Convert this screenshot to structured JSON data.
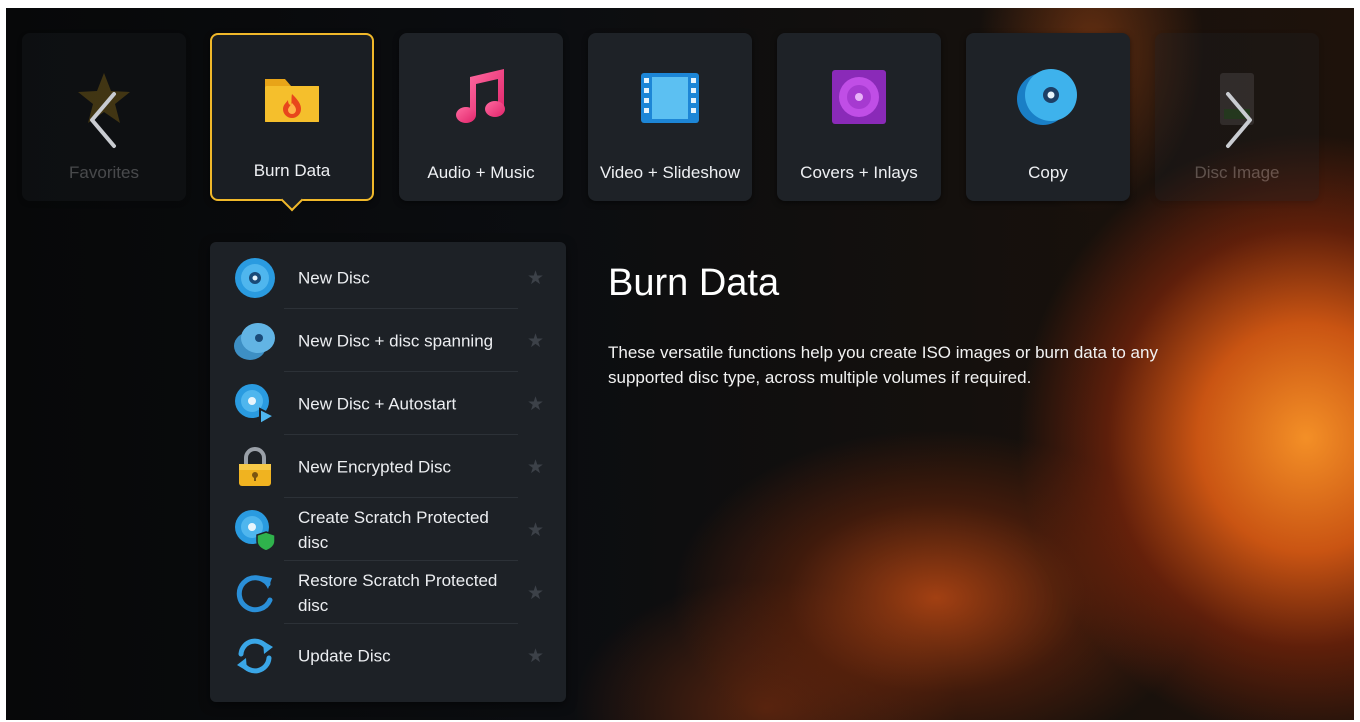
{
  "categories": [
    {
      "label": "Favorites",
      "icon": "star-icon",
      "state": "dimmed"
    },
    {
      "label": "Burn Data",
      "icon": "folder-flame-icon",
      "state": "selected"
    },
    {
      "label": "Audio + Music",
      "icon": "music-note-icon",
      "state": "normal"
    },
    {
      "label": "Video + Slideshow",
      "icon": "film-strip-icon",
      "state": "normal"
    },
    {
      "label": "Covers + Inlays",
      "icon": "disc-cover-icon",
      "state": "normal"
    },
    {
      "label": "Copy",
      "icon": "copy-disc-icon",
      "state": "normal"
    },
    {
      "label": "Disc Image",
      "icon": "disc-image-icon",
      "state": "dimmed"
    }
  ],
  "nav": {
    "prev_icon": "chevron-left-icon",
    "next_icon": "chevron-right-icon"
  },
  "menu": {
    "items": [
      {
        "label": "New Disc",
        "icon": "disc-icon"
      },
      {
        "label": "New Disc + disc spanning",
        "icon": "disc-stack-icon"
      },
      {
        "label": "New Disc + Autostart",
        "icon": "disc-autostart-icon"
      },
      {
        "label": "New Encrypted Disc",
        "icon": "padlock-icon"
      },
      {
        "label": "Create Scratch Protected disc",
        "icon": "disc-shield-icon"
      },
      {
        "label": "Restore Scratch Protected disc",
        "icon": "restore-icon"
      },
      {
        "label": "Update Disc",
        "icon": "refresh-icon"
      }
    ],
    "favorite_icon": "star-icon"
  },
  "info": {
    "title": "Burn Data",
    "description": "These versatile functions help you create ISO images or burn data to any supported disc type, across multiple volumes if required."
  },
  "colors": {
    "accent": "#f0b82a",
    "tile_bg": "#1e2227",
    "panel_bg": "#1d2126",
    "disc_blue": "#2a9be0"
  }
}
